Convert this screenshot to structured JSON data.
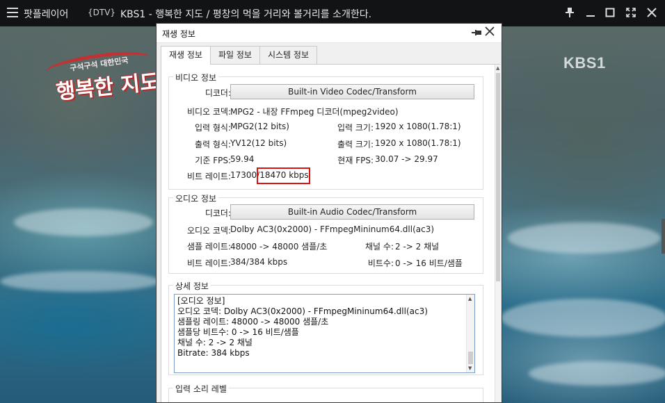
{
  "titlebar": {
    "app_name": "팟플레이어",
    "source_tag": "{DTV}",
    "video_title": "KBS1 - 행복한 지도 / 평창의 먹을 거리와 볼거리를 소개한다.",
    "buttons": [
      "pin-icon",
      "minimize-icon",
      "maximize-icon",
      "fullscreen-icon",
      "close-icon"
    ]
  },
  "video": {
    "show_logo_small": "구석구석 대한민국",
    "show_logo_big": "행복한 지도",
    "channel_logo": "KBS1"
  },
  "dialog": {
    "title": "재생 정보",
    "tabs": [
      {
        "label": "재생 정보",
        "active": true
      },
      {
        "label": "파일 정보",
        "active": false
      },
      {
        "label": "시스템 정보",
        "active": false
      }
    ],
    "video": {
      "group": "비디오 정보",
      "decoder_label": "디코더:",
      "decoder": "Built-in Video Codec/Transform",
      "codec_label": "비디오 코덱:",
      "codec": "MPG2 - 내장 FFmpeg 디코더(mpeg2video)",
      "input_format_label": "입력 형식:",
      "input_format": "MPG2(12 bits)",
      "input_size_label": "입력 크기:",
      "input_size": "1920 x 1080(1.78:1)",
      "output_format_label": "출력 형식:",
      "output_format": "YV12(12 bits)",
      "output_size_label": "출력 크기:",
      "output_size": "1920 x 1080(1.78:1)",
      "base_fps_label": "기준 FPS:",
      "base_fps": "59.94",
      "current_fps_label": "현재 FPS:",
      "current_fps": "30.07 -> 29.97",
      "bitrate_label": "비트 레이트:",
      "bitrate_a": "17300/",
      "bitrate_b": "18470 kbps"
    },
    "audio": {
      "group": "오디오 정보",
      "decoder_label": "디코더:",
      "decoder": "Built-in Audio Codec/Transform",
      "codec_label": "오디오 코덱:",
      "codec": "Dolby AC3(0x2000) - FFmpegMininum64.dll(ac3)",
      "samplerate_label": "샘플 레이트:",
      "samplerate": "48000 -> 48000 샘플/초",
      "channels_label": "채널 수:",
      "channels": "2 -> 2 채널",
      "bitrate_label": "비트 레이트:",
      "bitrate": "384/384 kbps",
      "bits_label": "비트수:",
      "bits": "0 -> 16 비트/샘플"
    },
    "details": {
      "group": "상세 정보",
      "lines": [
        "[오디오 정보]",
        "오디오 코덱: Dolby AC3(0x2000) - FFmpegMininum64.dll(ac3)",
        "샘플링 레이트: 48000 -> 48000 샘플/초",
        "샘플당 비트수: 0 -> 16 비트/샘플",
        "채널 수: 2 -> 2 채널",
        "Bitrate: 384 kbps"
      ]
    },
    "input_level": {
      "group": "입력 소리 레벨"
    }
  },
  "colors": {
    "titlebar_bg": "#0c0c0e",
    "highlight": "#dd1111",
    "detail_border": "#7a9cc6"
  }
}
